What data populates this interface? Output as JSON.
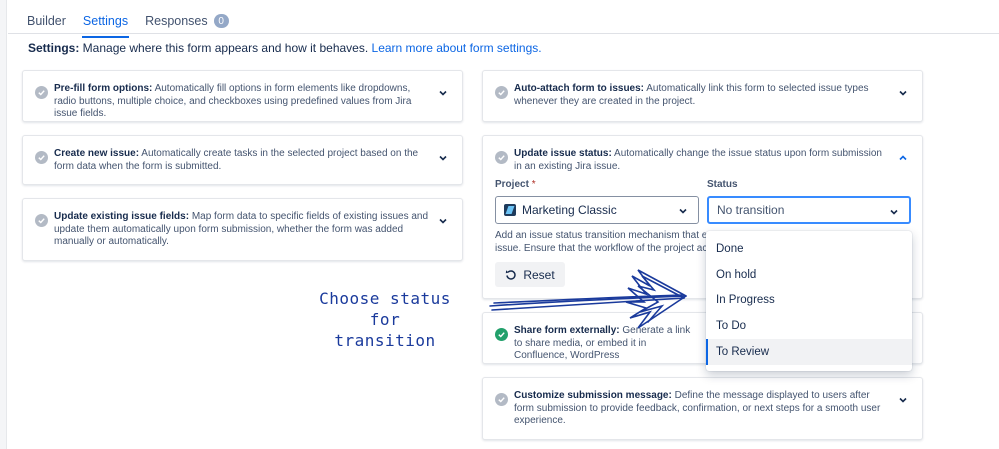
{
  "tabs": [
    {
      "label": "Builder"
    },
    {
      "label": "Settings"
    },
    {
      "label": "Responses",
      "badge": "0"
    }
  ],
  "intro": {
    "bold": "Settings:",
    "text": " Manage where this form appears and how it behaves. ",
    "link": "Learn more about form settings."
  },
  "cards": {
    "prefill": {
      "title": "Pre-fill form options:",
      "desc": " Automatically fill options in form elements like dropdowns, radio buttons, multiple choice, and checkboxes using predefined values from Jira issue fields."
    },
    "create": {
      "title": "Create new issue:",
      "desc": " Automatically create tasks in the selected project based on the form data when the form is submitted."
    },
    "update_fields": {
      "title": "Update existing issue fields:",
      "desc": " Map form data to specific fields of existing issues and update them automatically upon form submission, whether the form was added manually or automatically."
    },
    "attach": {
      "title": "Auto-attach form to issues:",
      "desc": " Automatically link this form to selected issue types whenever they are created in the project."
    },
    "update_status": {
      "title": "Update issue status:",
      "desc": " Automatically change the issue status upon form submission in an existing Jira issue."
    },
    "share": {
      "title": "Share form externally:",
      "desc": " Generate a link to share media, or embed it in Confluence, WordPress"
    },
    "customize": {
      "title": "Customize submission message:",
      "desc": " Define the message displayed to users after form submission to provide feedback, confirmation, or next steps for a smooth user experience."
    }
  },
  "status_panel": {
    "project_label": "Project",
    "required_mark": "*",
    "project_value": "Marketing Classic",
    "status_label": "Status",
    "status_value": "No transition",
    "hint_line1": "Add an issue status transition mechanism that ex",
    "hint_line2": "issue. Ensure that the workflow of the project acc",
    "reset_label": "Reset"
  },
  "status_menu": {
    "options": [
      "Done",
      "On hold",
      "In Progress",
      "To Do",
      "To Review"
    ],
    "highlighted": "To Review"
  },
  "annotation": {
    "line1": "Choose status for",
    "line2": "transition"
  },
  "colors": {
    "accent": "#0c66e4",
    "success": "#22a06b",
    "annotation_ink": "#1a3a9c"
  }
}
